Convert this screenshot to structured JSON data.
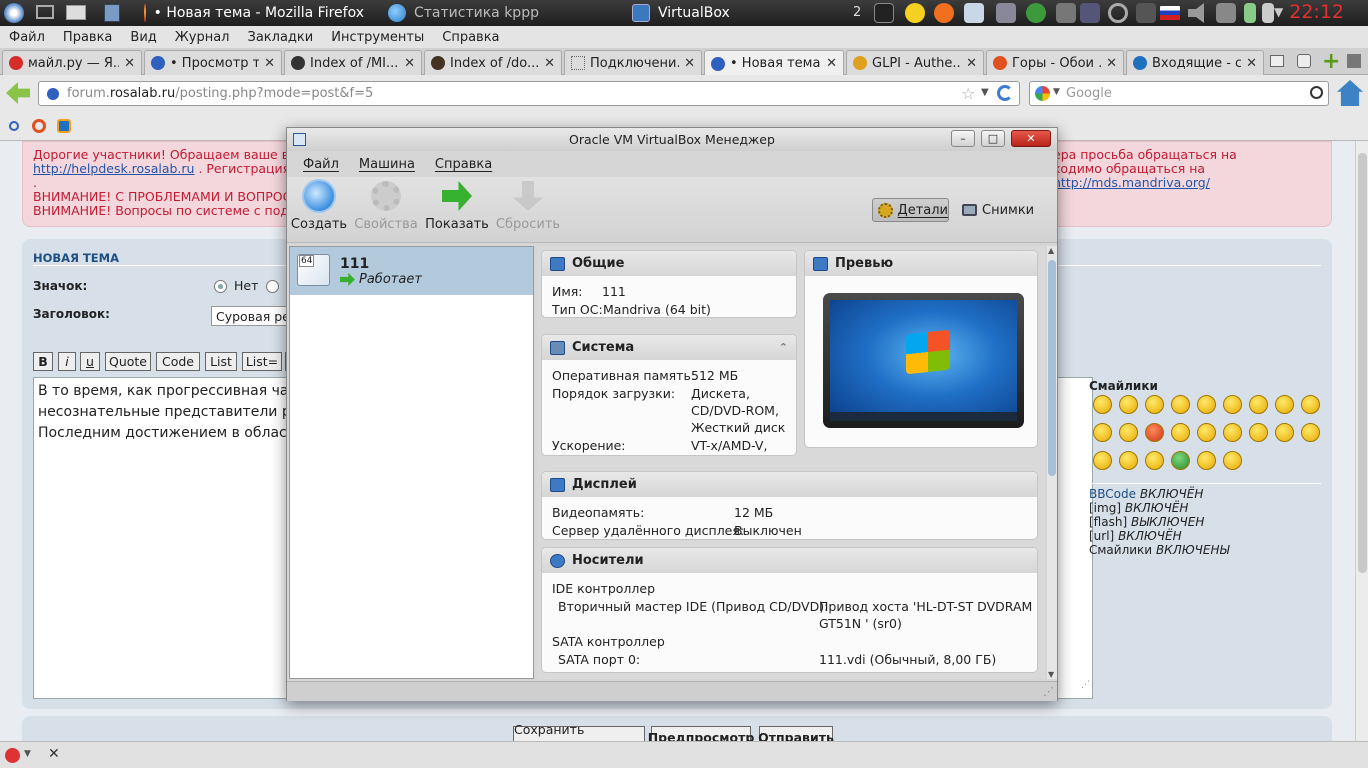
{
  "taskbar": {
    "tasks": [
      {
        "label": "• Новая тема - Mozilla Firefox",
        "active": true
      },
      {
        "label": "Статистика kppp",
        "active": false
      },
      {
        "label": "VirtualBox",
        "active": true
      }
    ],
    "desktop_count": "2",
    "clock": "22:12"
  },
  "firefox": {
    "menu": [
      "Файл",
      "Правка",
      "Вид",
      "Журнал",
      "Закладки",
      "Инструменты",
      "Справка"
    ],
    "tabs": [
      {
        "label": "майл.ру — Я...",
        "color": "#d62c2c"
      },
      {
        "label": "• Просмотр т...",
        "color": "#2f5fbf"
      },
      {
        "label": "Index of /MI...",
        "color": "#333333"
      },
      {
        "label": "Index of /do...",
        "color": "#443322"
      },
      {
        "label": "Подключени...",
        "color": "#888888"
      },
      {
        "label": "• Новая тема",
        "color": "#2f5fbf",
        "selected": true
      },
      {
        "label": "GLPI - Authe...",
        "color": "#e0a020"
      },
      {
        "label": "Горы - Обои ...",
        "color": "#e05020"
      },
      {
        "label": "Входящие - с...",
        "color": "#2070c0"
      }
    ],
    "url_host": "forum.",
    "url_domain": "rosalab.ru",
    "url_path": "/posting.php?mode=post&f=5",
    "search_placeholder": "Google"
  },
  "page": {
    "notice_line1": "Дорогие участники! Обращаем ваше вниман",
    "notice_line1_right": "ера просьба обращаться на",
    "notice_link1": "http://helpdesk.rosalab.ru",
    "notice_line2": ". Регистрация на хел",
    "notice_line2_right": "ходимо обращаться на",
    "notice_link2": "http://mds.mandriva.org/",
    "notice_dot": ".",
    "notice_line3": "ВНИМАНИЕ! С ПРОБЛЕМАМИ И ВОПРОСАМ",
    "notice_line4": "ВНИМАНИЕ! Вопросы по системе с подключ",
    "form_title": "НОВАЯ ТЕМА",
    "icon_label": "Значок:",
    "icon_none": "Нет",
    "subject_label": "Заголовок:",
    "subject_value": "Суровая реа",
    "bbcode_buttons": [
      "B",
      "i",
      "u",
      "Quote",
      "Code",
      "List",
      "List="
    ],
    "editor_lines": [
      "В то время, как прогрессивная часть",
      "несознательные представители рода",
      "Последним достижением в области (I"
    ],
    "smiles_title": "Смайлики",
    "status_lines": [
      {
        "key": "BBCode",
        "value": "ВКЛЮЧЁН"
      },
      {
        "key": "[img]",
        "value": "ВКЛЮЧЁН"
      },
      {
        "key": "[flash]",
        "value": "ВЫКЛЮЧЕН"
      },
      {
        "key": "[url]",
        "value": "ВКЛЮЧЁН"
      },
      {
        "key": "Смайлики",
        "value": "ВКЛЮЧЕНЫ"
      }
    ],
    "buttons": {
      "draft": "Сохранить черновик",
      "preview": "Предпросмотр",
      "submit": "Отправить"
    }
  },
  "virtualbox": {
    "title": "Oracle VM VirtualBox Менеджер",
    "menu": [
      "Файл",
      "Машина",
      "Справка"
    ],
    "toolbar": {
      "create": "Создать",
      "settings": "Свойства",
      "show": "Показать",
      "discard": "Сбросить",
      "details": "Детали",
      "snapshots": "Снимки"
    },
    "vm": {
      "name": "111",
      "state": "Работает",
      "badge": "64"
    },
    "general": {
      "title": "Общие",
      "name_label": "Имя:",
      "name_value": "111",
      "os_label": "Тип ОС:",
      "os_value": "Mandriva (64 bit)"
    },
    "preview": {
      "title": "Превью"
    },
    "system": {
      "title": "Система",
      "ram_label": "Оперативная память:",
      "ram_value": "512 МБ",
      "boot_label": "Порядок загрузки:",
      "boot_values": [
        "Дискета,",
        "CD/DVD-ROM,",
        "Жесткий диск"
      ],
      "accel_label": "Ускорение:",
      "accel_value": "VT-x/AMD-V,"
    },
    "display": {
      "title": "Дисплей",
      "vram_label": "Видеопамять:",
      "vram_value": "12 МБ",
      "rdp_label": "Сервер удалённого дисплея:",
      "rdp_value": "Выключен"
    },
    "storage": {
      "title": "Носители",
      "ide_label": "IDE контроллер",
      "ide_dev_label": "Вторичный мастер IDE (Привод CD/DVD):",
      "ide_dev_value1": "Привод хоста 'HL-DT-ST DVDRAM",
      "ide_dev_value2": "GT51N ' (sr0)",
      "sata_label": "SATA контроллер",
      "sata_port_label": "SATA порт 0:",
      "sata_port_value": "111.vdi (Обычный, 8,00 ГБ)"
    }
  },
  "colors": {
    "accent_red": "#e23030",
    "notice_text": "#c21c33",
    "selection": "#b3c9dc"
  }
}
